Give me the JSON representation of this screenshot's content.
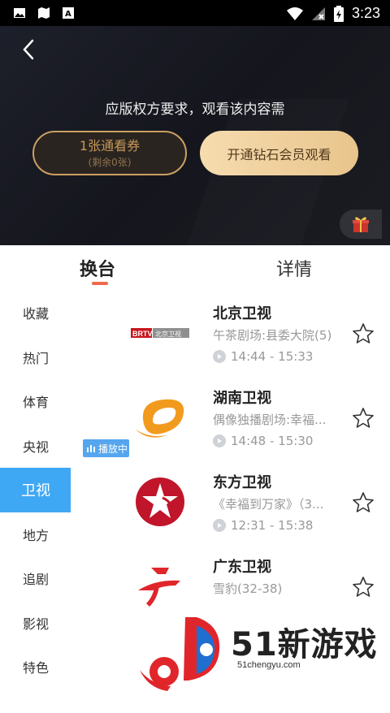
{
  "status_bar": {
    "time": "3:23"
  },
  "player": {
    "rights_text": "应版权方要求，观看该内容需",
    "ticket_label": "1张通看券",
    "ticket_remaining": "(剩余0张)",
    "vip_label": "开通钻石会员观看"
  },
  "tabs": [
    {
      "label": "换台",
      "active": true
    },
    {
      "label": "详情",
      "active": false
    }
  ],
  "categories": [
    "收藏",
    "热门",
    "体育",
    "央视",
    "卫视",
    "地方",
    "追剧",
    "影视",
    "特色"
  ],
  "active_category": "卫视",
  "channels": [
    {
      "name": "北京卫视",
      "program": "午茶剧场:县委大院(5)",
      "time": "14:44 - 15:33",
      "logo_text": "BRTV 北京卫视"
    },
    {
      "name": "湖南卫视",
      "program": "偶像独播剧场:幸福...",
      "time": "14:48 - 15:30",
      "badge": "播放中"
    },
    {
      "name": "东方卫视",
      "program": "《幸福到万家》（3...",
      "time": "12:31 - 15:38"
    },
    {
      "name": "广东卫视",
      "program": "雪豹(32-38)"
    }
  ],
  "watermark": {
    "text": "51新游戏",
    "url": "51chengyu.com"
  },
  "colors": {
    "accent": "#3fa8f4",
    "gold": "#e8c48b",
    "tab_underline": "#ef6a4a"
  }
}
